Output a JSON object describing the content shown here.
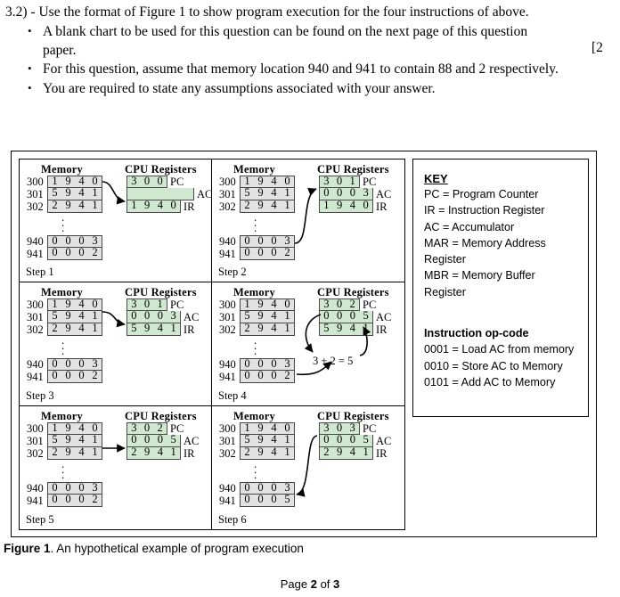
{
  "question": {
    "number": "3.2)",
    "dash": "-",
    "intro": "Use the format of Figure 1 to show program execution for the four instructions of above.",
    "bullets": [
      "A blank chart to be used for this question can be found on the next page of this question paper.",
      "For this question, assume that memory location 940 and 941 to contain 88 and 2 respectively.",
      "You are required to state any assumptions associated with your answer."
    ],
    "marks": "[2"
  },
  "figure": {
    "headers": {
      "memory": "Memory",
      "cpu": "CPU Registers"
    },
    "labels": {
      "pc": "PC",
      "ac": "AC",
      "ir": "IR"
    },
    "steps": [
      {
        "label": "Step 1",
        "memory_top": [
          {
            "addr": "300",
            "word": [
              "1",
              "9",
              "4",
              "0"
            ]
          },
          {
            "addr": "301",
            "word": [
              "5",
              "9",
              "4",
              "1"
            ]
          },
          {
            "addr": "302",
            "word": [
              "2",
              "9",
              "4",
              "1"
            ]
          }
        ],
        "memory_bottom": [
          {
            "addr": "940",
            "word": [
              "0",
              "0",
              "0",
              "3"
            ]
          },
          {
            "addr": "941",
            "word": [
              "0",
              "0",
              "0",
              "2"
            ]
          }
        ],
        "registers": {
          "pc": [
            "3",
            "0",
            "0"
          ],
          "ac": [],
          "ir": [
            "1",
            "9",
            "4",
            "0"
          ]
        },
        "annotation": ""
      },
      {
        "label": "Step 2",
        "memory_top": [
          {
            "addr": "300",
            "word": [
              "1",
              "9",
              "4",
              "0"
            ]
          },
          {
            "addr": "301",
            "word": [
              "5",
              "9",
              "4",
              "1"
            ]
          },
          {
            "addr": "302",
            "word": [
              "2",
              "9",
              "4",
              "1"
            ]
          }
        ],
        "memory_bottom": [
          {
            "addr": "940",
            "word": [
              "0",
              "0",
              "0",
              "3"
            ]
          },
          {
            "addr": "941",
            "word": [
              "0",
              "0",
              "0",
              "2"
            ]
          }
        ],
        "registers": {
          "pc": [
            "3",
            "0",
            "1"
          ],
          "ac": [
            "0",
            "0",
            "0",
            "3"
          ],
          "ir": [
            "1",
            "9",
            "4",
            "0"
          ]
        },
        "annotation": ""
      },
      {
        "label": "Step 3",
        "memory_top": [
          {
            "addr": "300",
            "word": [
              "1",
              "9",
              "4",
              "0"
            ]
          },
          {
            "addr": "301",
            "word": [
              "5",
              "9",
              "4",
              "1"
            ]
          },
          {
            "addr": "302",
            "word": [
              "2",
              "9",
              "4",
              "1"
            ]
          }
        ],
        "memory_bottom": [
          {
            "addr": "940",
            "word": [
              "0",
              "0",
              "0",
              "3"
            ]
          },
          {
            "addr": "941",
            "word": [
              "0",
              "0",
              "0",
              "2"
            ]
          }
        ],
        "registers": {
          "pc": [
            "3",
            "0",
            "1"
          ],
          "ac": [
            "0",
            "0",
            "0",
            "3"
          ],
          "ir": [
            "5",
            "9",
            "4",
            "1"
          ]
        },
        "annotation": ""
      },
      {
        "label": "Step 4",
        "memory_top": [
          {
            "addr": "300",
            "word": [
              "1",
              "9",
              "4",
              "0"
            ]
          },
          {
            "addr": "301",
            "word": [
              "5",
              "9",
              "4",
              "1"
            ]
          },
          {
            "addr": "302",
            "word": [
              "2",
              "9",
              "4",
              "1"
            ]
          }
        ],
        "memory_bottom": [
          {
            "addr": "940",
            "word": [
              "0",
              "0",
              "0",
              "3"
            ]
          },
          {
            "addr": "941",
            "word": [
              "0",
              "0",
              "0",
              "2"
            ]
          }
        ],
        "registers": {
          "pc": [
            "3",
            "0",
            "2"
          ],
          "ac": [
            "0",
            "0",
            "0",
            "5"
          ],
          "ir": [
            "5",
            "9",
            "4",
            "1"
          ]
        },
        "annotation": "3 + 2 = 5"
      },
      {
        "label": "Step 5",
        "memory_top": [
          {
            "addr": "300",
            "word": [
              "1",
              "9",
              "4",
              "0"
            ]
          },
          {
            "addr": "301",
            "word": [
              "5",
              "9",
              "4",
              "1"
            ]
          },
          {
            "addr": "302",
            "word": [
              "2",
              "9",
              "4",
              "1"
            ]
          }
        ],
        "memory_bottom": [
          {
            "addr": "940",
            "word": [
              "0",
              "0",
              "0",
              "3"
            ]
          },
          {
            "addr": "941",
            "word": [
              "0",
              "0",
              "0",
              "2"
            ]
          }
        ],
        "registers": {
          "pc": [
            "3",
            "0",
            "2"
          ],
          "ac": [
            "0",
            "0",
            "0",
            "5"
          ],
          "ir": [
            "2",
            "9",
            "4",
            "1"
          ]
        },
        "annotation": ""
      },
      {
        "label": "Step 6",
        "memory_top": [
          {
            "addr": "300",
            "word": [
              "1",
              "9",
              "4",
              "0"
            ]
          },
          {
            "addr": "301",
            "word": [
              "5",
              "9",
              "4",
              "1"
            ]
          },
          {
            "addr": "302",
            "word": [
              "2",
              "9",
              "4",
              "1"
            ]
          }
        ],
        "memory_bottom": [
          {
            "addr": "940",
            "word": [
              "0",
              "0",
              "0",
              "3"
            ]
          },
          {
            "addr": "941",
            "word": [
              "0",
              "0",
              "0",
              "5"
            ]
          }
        ],
        "registers": {
          "pc": [
            "3",
            "0",
            "3"
          ],
          "ac": [
            "0",
            "0",
            "0",
            "5"
          ],
          "ir": [
            "2",
            "9",
            "4",
            "1"
          ]
        },
        "annotation": ""
      }
    ]
  },
  "key": {
    "title": "KEY",
    "lines": [
      "PC =  Program Counter",
      "IR = Instruction Register",
      "AC = Accumulator",
      "MAR = Memory Address",
      "Register",
      "MBR = Memory Buffer",
      "Register"
    ],
    "opcode_title": "Instruction op-code",
    "opcodes": [
      "0001 = Load AC from memory",
      "0010 = Store AC to Memory",
      "0101 = Add AC to Memory"
    ]
  },
  "caption": {
    "bold": "Figure 1",
    "rest": ". An hypothetical example of program execution"
  },
  "footer": {
    "pre": "Page ",
    "page": "2",
    "mid": " of ",
    "total": "3"
  },
  "colors": {
    "memory_cell": "#e2e2e2",
    "register_cell": "#cfe8cf",
    "border": "#000000"
  }
}
